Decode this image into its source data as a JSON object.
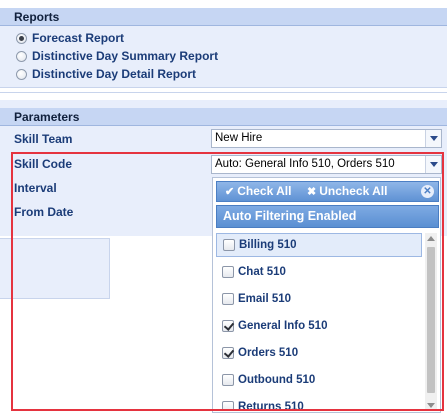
{
  "reports": {
    "header": "Reports",
    "options": [
      {
        "label": "Forecast Report",
        "checked": true
      },
      {
        "label": "Distinctive Day Summary Report",
        "checked": false
      },
      {
        "label": "Distinctive Day Detail Report",
        "checked": false
      }
    ]
  },
  "parameters": {
    "header": "Parameters",
    "skill_team_label": "Skill Team",
    "skill_team_value": "New Hire",
    "skill_code_label": "Skill Code",
    "skill_code_value": "Auto: General Info 510, Orders 510",
    "interval_label": "Interval",
    "from_date_label": "From Date"
  },
  "dropdown": {
    "check_all": "Check All",
    "uncheck_all": "Uncheck All",
    "banner": "Auto Filtering Enabled",
    "items": [
      {
        "label": "Billing 510",
        "checked": false
      },
      {
        "label": "Chat 510",
        "checked": false
      },
      {
        "label": "Email 510",
        "checked": false
      },
      {
        "label": "General Info 510",
        "checked": true
      },
      {
        "label": "Orders 510",
        "checked": true
      },
      {
        "label": "Outbound 510",
        "checked": false
      },
      {
        "label": "Returns 510",
        "checked": false
      }
    ]
  },
  "colors": {
    "accent": "#5f92d4",
    "highlight": "#e5333f",
    "panel": "#e8eefb"
  }
}
